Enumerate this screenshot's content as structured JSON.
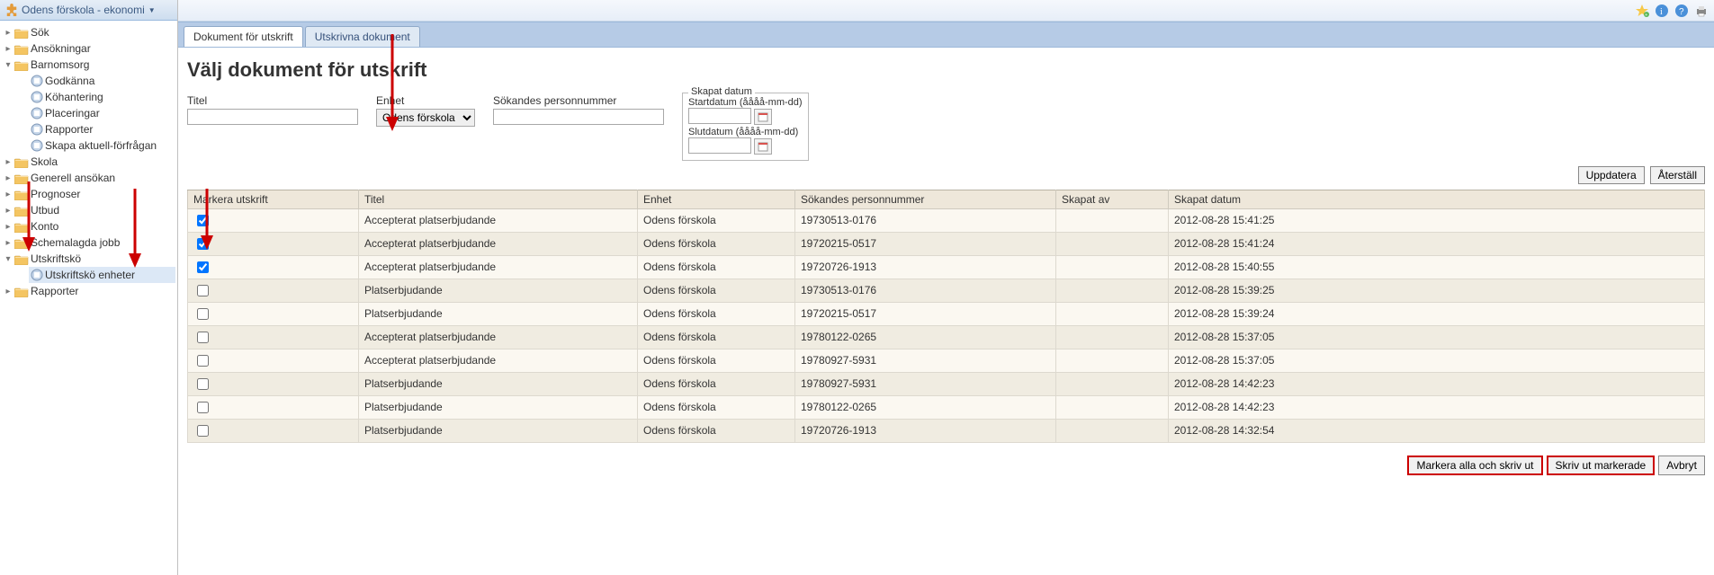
{
  "sidebar": {
    "title": "Odens förskola - ekonomi",
    "nodes": [
      {
        "label": "Sök",
        "expanded": false,
        "icon": "folder"
      },
      {
        "label": "Ansökningar",
        "expanded": false,
        "icon": "folder"
      },
      {
        "label": "Barnomsorg",
        "expanded": true,
        "icon": "folder",
        "children": [
          {
            "label": "Godkänna",
            "icon": "leaf"
          },
          {
            "label": "Köhantering",
            "icon": "leaf"
          },
          {
            "label": "Placeringar",
            "icon": "leaf"
          },
          {
            "label": "Rapporter",
            "icon": "leaf"
          },
          {
            "label": "Skapa aktuell-förfrågan",
            "icon": "leaf"
          }
        ]
      },
      {
        "label": "Skola",
        "expanded": false,
        "icon": "folder"
      },
      {
        "label": "Generell ansökan",
        "expanded": false,
        "icon": "folder"
      },
      {
        "label": "Prognoser",
        "expanded": false,
        "icon": "folder"
      },
      {
        "label": "Utbud",
        "expanded": false,
        "icon": "folder"
      },
      {
        "label": "Konto",
        "expanded": false,
        "icon": "folder"
      },
      {
        "label": "Schemalagda jobb",
        "expanded": false,
        "icon": "folder"
      },
      {
        "label": "Utskriftskö",
        "expanded": true,
        "icon": "folder",
        "children": [
          {
            "label": "Utskriftskö enheter",
            "icon": "leaf",
            "selected": true
          }
        ]
      },
      {
        "label": "Rapporter",
        "expanded": false,
        "icon": "folder"
      }
    ]
  },
  "tabs": [
    {
      "label": "Dokument för utskrift",
      "active": true
    },
    {
      "label": "Utskrivna dokument",
      "active": false
    }
  ],
  "page_title": "Välj dokument för utskrift",
  "filters": {
    "title_label": "Titel",
    "unit_label": "Enhet",
    "unit_value": "Odens förskola",
    "pnr_label": "Sökandes personnummer",
    "date_group_label": "Skapat datum",
    "start_label": "Startdatum (åååå-mm-dd)",
    "end_label": "Slutdatum (åååå-mm-dd)"
  },
  "buttons": {
    "update": "Uppdatera",
    "reset": "Återställ",
    "mark_all_print": "Markera alla och skriv ut",
    "print_marked": "Skriv ut markerade",
    "cancel": "Avbryt"
  },
  "table": {
    "headers": [
      "Markera utskrift",
      "Titel",
      "Enhet",
      "Sökandes personnummer",
      "Skapat av",
      "Skapat datum"
    ],
    "rows": [
      {
        "checked": true,
        "title": "Accepterat platserbjudande",
        "unit": "Odens förskola",
        "pnr": "19730513-0176",
        "by": "",
        "date": "2012-08-28 15:41:25"
      },
      {
        "checked": true,
        "title": "Accepterat platserbjudande",
        "unit": "Odens förskola",
        "pnr": "19720215-0517",
        "by": "",
        "date": "2012-08-28 15:41:24"
      },
      {
        "checked": true,
        "title": "Accepterat platserbjudande",
        "unit": "Odens förskola",
        "pnr": "19720726-1913",
        "by": "",
        "date": "2012-08-28 15:40:55"
      },
      {
        "checked": false,
        "title": "Platserbjudande",
        "unit": "Odens förskola",
        "pnr": "19730513-0176",
        "by": "",
        "date": "2012-08-28 15:39:25"
      },
      {
        "checked": false,
        "title": "Platserbjudande",
        "unit": "Odens förskola",
        "pnr": "19720215-0517",
        "by": "",
        "date": "2012-08-28 15:39:24"
      },
      {
        "checked": false,
        "title": "Accepterat platserbjudande",
        "unit": "Odens förskola",
        "pnr": "19780122-0265",
        "by": "",
        "date": "2012-08-28 15:37:05"
      },
      {
        "checked": false,
        "title": "Accepterat platserbjudande",
        "unit": "Odens förskola",
        "pnr": "19780927-5931",
        "by": "",
        "date": "2012-08-28 15:37:05"
      },
      {
        "checked": false,
        "title": "Platserbjudande",
        "unit": "Odens förskola",
        "pnr": "19780927-5931",
        "by": "",
        "date": "2012-08-28 14:42:23"
      },
      {
        "checked": false,
        "title": "Platserbjudande",
        "unit": "Odens förskola",
        "pnr": "19780122-0265",
        "by": "",
        "date": "2012-08-28 14:42:23"
      },
      {
        "checked": false,
        "title": "Platserbjudande",
        "unit": "Odens förskola",
        "pnr": "19720726-1913",
        "by": "",
        "date": "2012-08-28 14:32:54"
      }
    ]
  }
}
